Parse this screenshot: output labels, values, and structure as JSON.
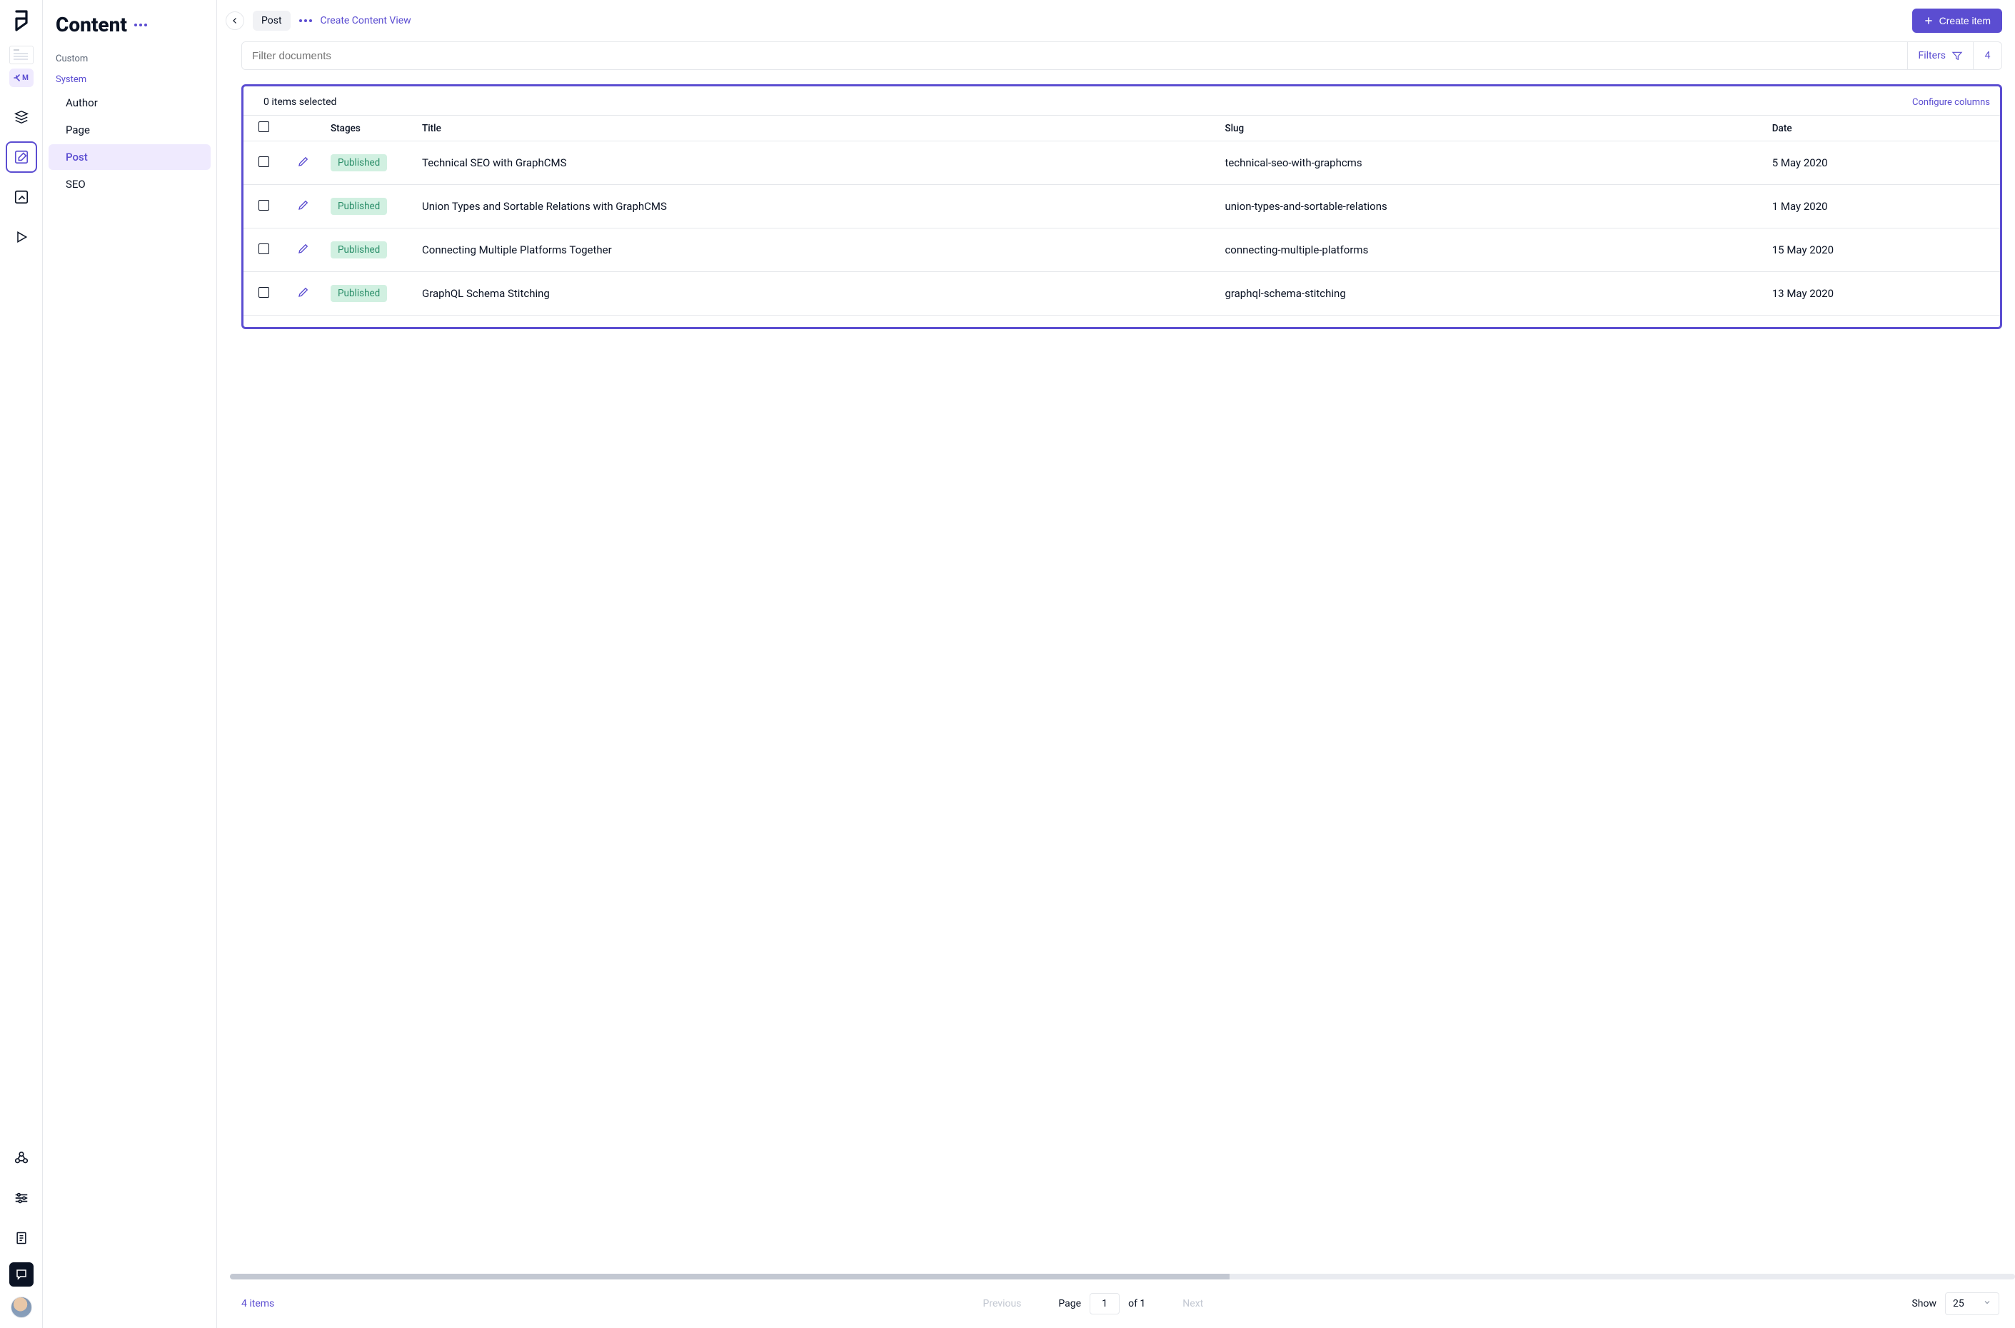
{
  "sidebar": {
    "title": "Content",
    "custom_label": "Custom",
    "system_label": "System",
    "items": [
      "Author",
      "Page",
      "Post",
      "SEO"
    ],
    "active_item": "Post"
  },
  "rail": {
    "thumbnail_label": "M"
  },
  "topbar": {
    "chip": "Post",
    "create_view": "Create Content View",
    "create_item": "Create item"
  },
  "filterbar": {
    "placeholder": "Filter documents",
    "filters_label": "Filters",
    "count": "4"
  },
  "table": {
    "selected_text": "0 items selected",
    "configure_label": "Configure columns",
    "columns": {
      "stages": "Stages",
      "title": "Title",
      "slug": "Slug",
      "date": "Date"
    },
    "rows": [
      {
        "stage": "Published",
        "title": "Technical SEO with GraphCMS",
        "slug": "technical-seo-with-graphcms",
        "date": "5 May 2020"
      },
      {
        "stage": "Published",
        "title": "Union Types and Sortable Relations with GraphCMS",
        "slug": "union-types-and-sortable-relations",
        "date": "1 May 2020"
      },
      {
        "stage": "Published",
        "title": "Connecting Multiple Platforms Together",
        "slug": "connecting-multiple-platforms",
        "date": "15 May 2020"
      },
      {
        "stage": "Published",
        "title": "GraphQL Schema Stitching",
        "slug": "graphql-schema-stitching",
        "date": "13 May 2020"
      }
    ]
  },
  "footer": {
    "count_label": "4 items",
    "previous": "Previous",
    "page_label": "Page",
    "page_value": "1",
    "of_label": "of 1",
    "next": "Next",
    "show_label": "Show",
    "page_size": "25"
  }
}
